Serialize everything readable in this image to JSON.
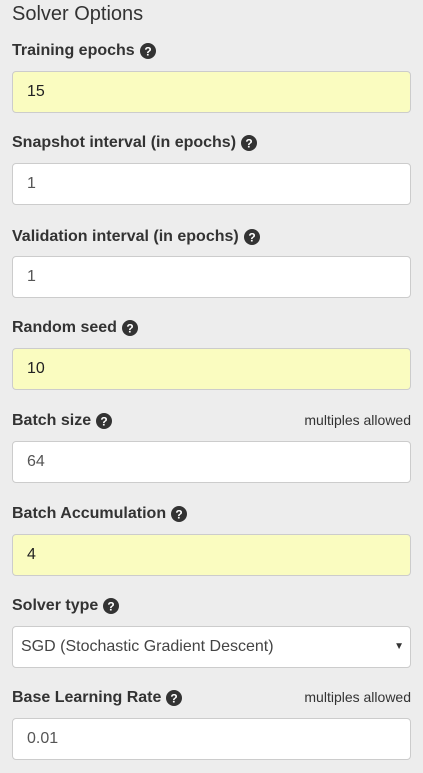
{
  "panel": {
    "title": "Solver Options"
  },
  "fields": {
    "training_epochs": {
      "label": "Training epochs",
      "value": "15"
    },
    "snapshot_interval": {
      "label": "Snapshot interval (in epochs)",
      "value": "1"
    },
    "validation_interval": {
      "label": "Validation interval (in epochs)",
      "value": "1"
    },
    "random_seed": {
      "label": "Random seed",
      "value": "10"
    },
    "batch_size": {
      "label": "Batch size",
      "hint": "multiples allowed",
      "value": "64"
    },
    "batch_accumulation": {
      "label": "Batch Accumulation",
      "value": "4"
    },
    "solver_type": {
      "label": "Solver type",
      "selected": "SGD (Stochastic Gradient Descent)"
    },
    "base_learning_rate": {
      "label": "Base Learning Rate",
      "hint": "multiples allowed",
      "value": "0.01"
    }
  },
  "icons": {
    "help": "question-circle-icon",
    "dropdown": "caret-down-icon"
  },
  "colors": {
    "background": "#ededed",
    "highlight_input": "#fafcc0",
    "input_border": "#cccccc"
  }
}
